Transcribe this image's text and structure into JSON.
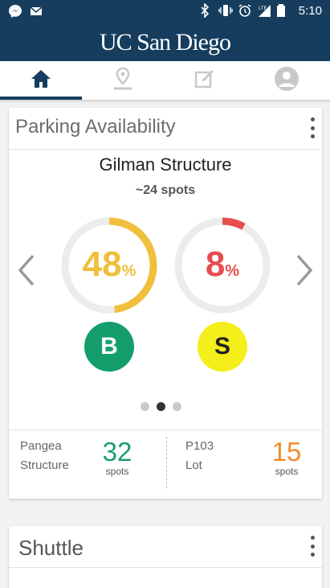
{
  "status_bar": {
    "time": "5:10",
    "network": "LTE"
  },
  "app": {
    "title": "UC San Diego"
  },
  "tabs": [
    {
      "name": "home",
      "icon": "home-icon",
      "active": true
    },
    {
      "name": "map",
      "icon": "map-pin-icon",
      "active": false
    },
    {
      "name": "edit",
      "icon": "edit-icon",
      "active": false
    },
    {
      "name": "profile",
      "icon": "person-icon",
      "active": false
    }
  ],
  "parking": {
    "card_title": "Parking Availability",
    "lot_name": "Gilman Structure",
    "lot_spots": "~24 spots",
    "gauges": [
      {
        "value": "48",
        "unit": "%",
        "fraction": 0.48,
        "color": "#f0bf3c",
        "permit": "B",
        "permit_color": "#139e6c",
        "permit_text_color": "#ffffff"
      },
      {
        "value": "8",
        "unit": "%",
        "fraction": 0.08,
        "color": "#e84d4f",
        "permit": "S",
        "permit_color": "#f4ee1a",
        "permit_text_color": "#222222"
      }
    ],
    "page_dots": {
      "count": 3,
      "active_index": 1
    },
    "nearby": [
      {
        "name_line1": "Pangea",
        "name_line2": "Structure",
        "count": "32",
        "unit": "spots",
        "color": "#1a9e6c"
      },
      {
        "name_line1": "P103",
        "name_line2": "Lot",
        "count": "15",
        "unit": "spots",
        "color": "#f08c2c"
      }
    ]
  },
  "shuttle": {
    "card_title": "Shuttle"
  }
}
